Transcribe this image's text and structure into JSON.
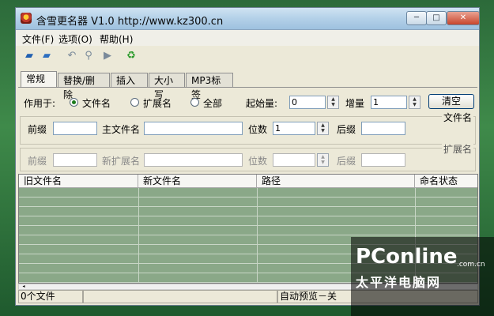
{
  "window": {
    "title": "含雪更名器 V1.0  http://www.kz300.cn"
  },
  "window_controls": {
    "minimize": "─",
    "maximize": "□",
    "close": "✕"
  },
  "menu": [
    "文件(F)",
    "选项(O)",
    "帮助(H)"
  ],
  "toolbar": {
    "icons": [
      "open-folder-icon",
      "open-file-icon",
      "undo-icon",
      "search-icon",
      "play-icon",
      "recycle-icon"
    ]
  },
  "tabs": [
    {
      "label": "常规",
      "active": true
    },
    {
      "label": "替换/删除",
      "active": false
    },
    {
      "label": "插入",
      "active": false
    },
    {
      "label": "大小写",
      "active": false
    },
    {
      "label": "MP3标签",
      "active": false
    }
  ],
  "general": {
    "apply_to_label": "作用于:",
    "radios": [
      {
        "label": "文件名",
        "selected": true
      },
      {
        "label": "扩展名",
        "selected": false
      },
      {
        "label": "全部",
        "selected": false
      }
    ],
    "start_label": "起始量:",
    "start_value": "0",
    "increment_label": "增量",
    "increment_value": "1",
    "clear_button": "清空"
  },
  "filename_group": {
    "title": "文件名",
    "prefix_label": "前缀",
    "prefix_value": "",
    "main_label": "主文件名",
    "main_value": "",
    "digits_label": "位数",
    "digits_value": "1",
    "suffix_label": "后缀",
    "suffix_value": ""
  },
  "extension_group": {
    "title": "扩展名",
    "prefix_label": "前缀",
    "prefix_value": "",
    "new_ext_label": "新扩展名",
    "new_ext_value": "",
    "digits_label": "位数",
    "digits_value": "",
    "suffix_label": "后缀",
    "suffix_value": ""
  },
  "grid": {
    "columns": [
      "旧文件名",
      "新文件名",
      "路径",
      "命名状态"
    ],
    "row_color": "#8aa888"
  },
  "status": {
    "file_count": "0个文件",
    "middle": "",
    "preview": "自动预览－关"
  },
  "watermark": {
    "logo": "PConline",
    "domain": ".com.cn",
    "subtitle": "太平洋电脑网"
  }
}
